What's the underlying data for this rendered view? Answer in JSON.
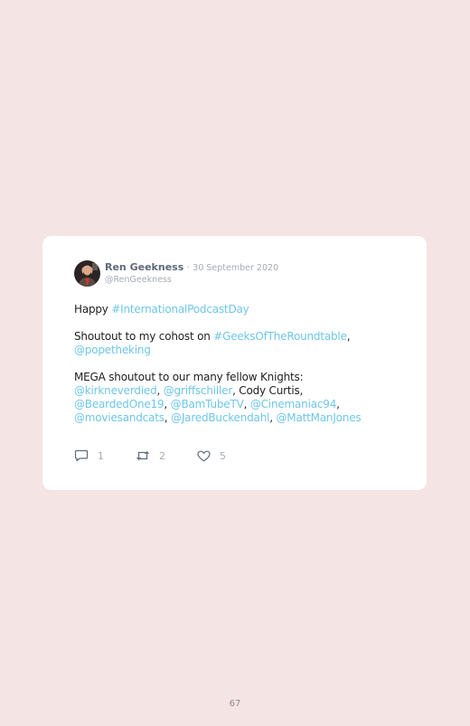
{
  "tweet": {
    "display_name": "Ren Geekness",
    "separator": "·",
    "date": "30 September 2020",
    "handle": "@RenGeekness",
    "paragraphs": [
      [
        {
          "text": "Happy ",
          "link": false
        },
        {
          "text": "#InternationalPodcastDay",
          "link": true
        }
      ],
      [
        {
          "text": "Shoutout to my cohost on ",
          "link": false
        },
        {
          "text": "#GeeksOfTheRoundtable",
          "link": true
        },
        {
          "text": ", ",
          "link": false
        },
        {
          "text": "@popetheking",
          "link": true
        }
      ],
      [
        {
          "text": "MEGA shoutout to our many fellow Knights: ",
          "link": false
        },
        {
          "text": "@kirkneverdied",
          "link": true
        },
        {
          "text": ", ",
          "link": false
        },
        {
          "text": "@griffschiller",
          "link": true
        },
        {
          "text": ", Cody Curtis, ",
          "link": false
        },
        {
          "text": "@BeardedOne19",
          "link": true
        },
        {
          "text": ", ",
          "link": false
        },
        {
          "text": "@BamTubeTV",
          "link": true
        },
        {
          "text": ", ",
          "link": false
        },
        {
          "text": "@Cinemaniac94",
          "link": true
        },
        {
          "text": ", ",
          "link": false
        },
        {
          "text": "@moviesandcats",
          "link": true
        },
        {
          "text": ", ",
          "link": false
        },
        {
          "text": "@JaredBuckendahl",
          "link": true
        },
        {
          "text": ", ",
          "link": false
        },
        {
          "text": "@MattManJones",
          "link": true
        }
      ]
    ],
    "actions": {
      "reply_icon": "speech-bubble-icon",
      "reply_count": "1",
      "retweet_icon": "retweet-icon",
      "retweet_count": "2",
      "like_icon": "heart-icon",
      "like_count": "5"
    }
  },
  "colors": {
    "background": "#f5e4e4",
    "card": "#ffffff",
    "link": "#6ec6e8",
    "muted": "#a5acb3"
  },
  "page_number": "67"
}
